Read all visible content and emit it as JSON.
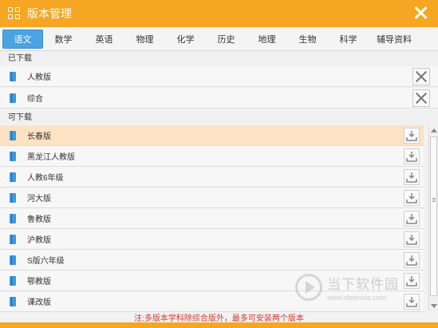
{
  "window": {
    "title": "版本管理"
  },
  "tabs": [
    {
      "label": "语文",
      "active": true
    },
    {
      "label": "数学"
    },
    {
      "label": "英语"
    },
    {
      "label": "物理"
    },
    {
      "label": "化学"
    },
    {
      "label": "历史"
    },
    {
      "label": "地理"
    },
    {
      "label": "生物"
    },
    {
      "label": "科学"
    },
    {
      "label": "辅导资料"
    }
  ],
  "downloaded": {
    "label": "已下载",
    "items": [
      {
        "label": "人教版"
      },
      {
        "label": "综合"
      }
    ]
  },
  "available": {
    "label": "可下载",
    "items": [
      {
        "label": "长春版",
        "highlighted": true
      },
      {
        "label": "黑龙江人教版"
      },
      {
        "label": "人教6年级"
      },
      {
        "label": "河大版"
      },
      {
        "label": "鲁教版"
      },
      {
        "label": "沪教版"
      },
      {
        "label": "S版六年级"
      },
      {
        "label": "鄂教版"
      },
      {
        "label": "课改版"
      }
    ]
  },
  "notice": "注:多版本学科除综合版外，最多可安装两个版本",
  "watermark": {
    "cn": "当下软件园",
    "en": "www.downxia.com"
  },
  "colors": {
    "accent": "#f6a623",
    "tab_active": "#4ba3e0",
    "book_icon": "#3f98dc",
    "highlight_row": "#fde3c4",
    "notice_text": "#d9362b"
  }
}
